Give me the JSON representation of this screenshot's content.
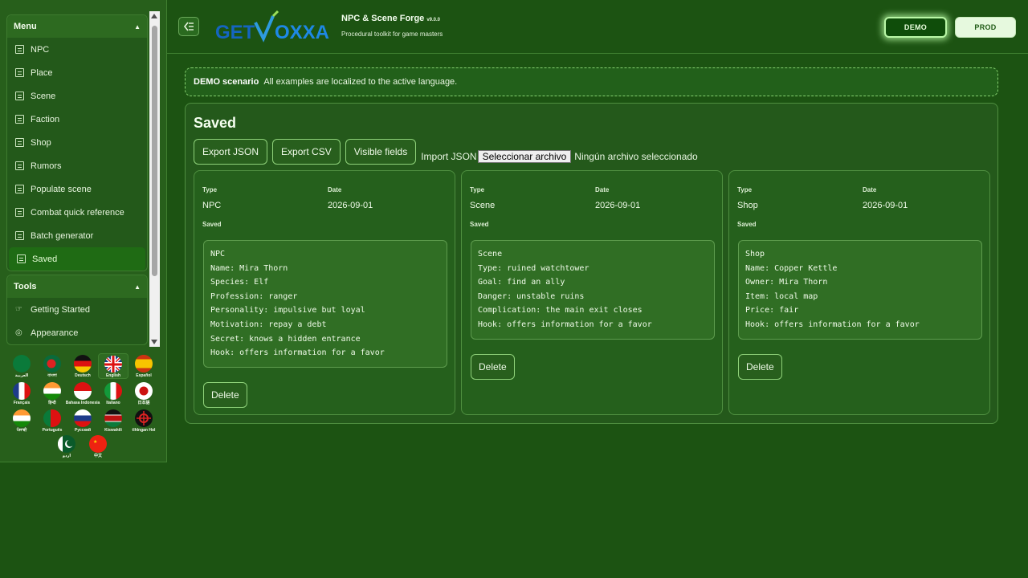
{
  "sidebar": {
    "menu_title": "Menu",
    "menu_items": [
      {
        "label": "NPC"
      },
      {
        "label": "Place"
      },
      {
        "label": "Scene"
      },
      {
        "label": "Faction"
      },
      {
        "label": "Shop"
      },
      {
        "label": "Rumors"
      },
      {
        "label": "Populate scene"
      },
      {
        "label": "Combat quick reference"
      },
      {
        "label": "Batch generator"
      },
      {
        "label": "Saved",
        "active": true
      }
    ],
    "tools_title": "Tools",
    "tools_items": [
      {
        "label": "Getting Started"
      },
      {
        "label": "Appearance"
      }
    ],
    "languages": [
      {
        "label": "العربية"
      },
      {
        "label": "বাংলা"
      },
      {
        "label": "Deutsch"
      },
      {
        "label": "English",
        "active": true
      },
      {
        "label": "Español"
      },
      {
        "label": "Français"
      },
      {
        "label": "हिन्दी"
      },
      {
        "label": "Bahasa Indonesia"
      },
      {
        "label": "Italiano"
      },
      {
        "label": "日本語"
      },
      {
        "label": "ਪੰਜਾਬੀ"
      },
      {
        "label": "Português"
      },
      {
        "label": "Русский"
      },
      {
        "label": "Kiswahili"
      },
      {
        "label": "tlhIngan Hol"
      },
      {
        "label": "اردو"
      },
      {
        "label": "中文"
      }
    ]
  },
  "header": {
    "logo_text": "GETVOXXA",
    "title": "NPC & Scene Forge",
    "version": "v9.0.0",
    "subtitle": "Procedural toolkit for game masters",
    "demo_label": "DEMO",
    "prod_label": "PROD"
  },
  "banner": {
    "strong": "DEMO scenario",
    "text": "All examples are localized to the active language."
  },
  "saved": {
    "title": "Saved",
    "export_json": "Export JSON",
    "export_csv": "Export CSV",
    "visible_fields": "Visible fields",
    "import_label": "Import JSON",
    "file_button": "Seleccionar archivo",
    "file_status": "Ningún archivo seleccionado",
    "type_label": "Type",
    "date_label": "Date",
    "saved_label": "Saved",
    "delete_label": "Delete",
    "cards": [
      {
        "type": "NPC",
        "date": "2026-09-01",
        "lines": [
          "NPC",
          "Name: Mira Thorn",
          "Species: Elf",
          "Profession: ranger",
          "Personality: impulsive but loyal",
          "Motivation: repay a debt",
          "Secret: knows a hidden entrance",
          "Hook: offers information for a favor"
        ]
      },
      {
        "type": "Scene",
        "date": "2026-09-01",
        "lines": [
          "Scene",
          "Type: ruined watchtower",
          "Goal: find an ally",
          "Danger: unstable ruins",
          "Complication: the main exit closes",
          "Hook: offers information for a favor"
        ]
      },
      {
        "type": "Shop",
        "date": "2026-09-01",
        "lines": [
          "Shop",
          "Name: Copper Kettle",
          "Owner: Mira Thorn",
          "Item: local map",
          "Price: fair",
          "Hook: offers information for a favor"
        ]
      }
    ]
  },
  "colors": {
    "background": "#1c5312",
    "accent": "#8fd27a",
    "demo_glow": "#b9f7a6"
  }
}
